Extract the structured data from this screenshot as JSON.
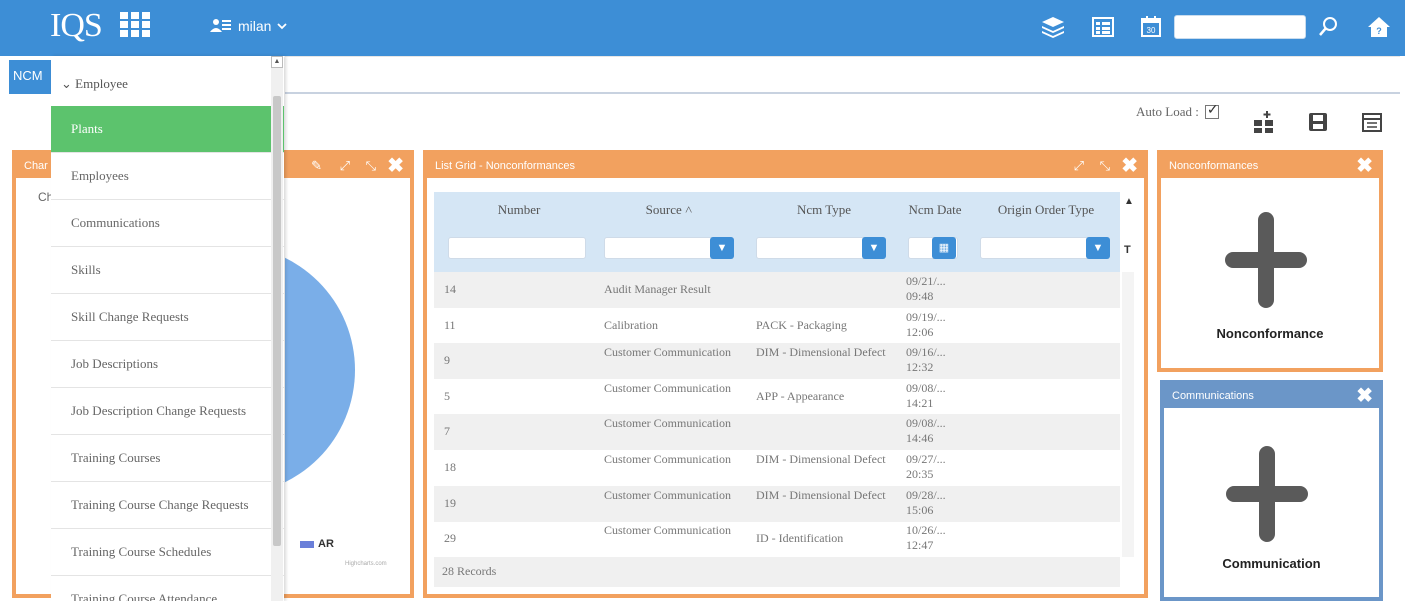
{
  "topbar": {
    "logo": "IQS",
    "user": "milan",
    "icons": [
      "apps-grid-icon",
      "user-icon",
      "chevron-down-icon",
      "layers-icon",
      "list-icon",
      "calendar-icon",
      "search-icon",
      "home-icon"
    ],
    "search_placeholder": "",
    "colors": {
      "bar": "#3d8ed6"
    }
  },
  "tabs": [
    {
      "label": "NCM"
    }
  ],
  "toolbar": {
    "autoload_label": "Auto Load :",
    "autoload_checked": true
  },
  "menu": {
    "header": "Employee",
    "items": [
      {
        "label": "Plants",
        "active": true
      },
      {
        "label": "Employees"
      },
      {
        "label": "Communications"
      },
      {
        "label": "Skills"
      },
      {
        "label": "Skill Change Requests"
      },
      {
        "label": "Job Descriptions"
      },
      {
        "label": "Job Description Change Requests"
      },
      {
        "label": "Training Courses"
      },
      {
        "label": "Training Course Change Requests"
      },
      {
        "label": "Training Course Schedules"
      },
      {
        "label": "Training Course Attendance"
      }
    ]
  },
  "chart_panel": {
    "title": "Char",
    "subtitle": "Ch",
    "legend": "AR",
    "credit": "Highcharts.com"
  },
  "grid_panel": {
    "title": "List Grid - Nonconformances",
    "columns": [
      "Number",
      "Source",
      "Ncm Type",
      "Ncm Date",
      "Origin Order Type"
    ],
    "rows": [
      {
        "number": "14",
        "source": "Audit Manager Result",
        "type": "",
        "date1": "09/21/...",
        "date2": "09:48"
      },
      {
        "number": "11",
        "source": "Calibration",
        "type": "PACK - Packaging",
        "date1": "09/19/...",
        "date2": "12:06"
      },
      {
        "number": "9",
        "source": "Customer Communication",
        "type": "DIM - Dimensional Defect",
        "date1": "09/16/...",
        "date2": "12:32"
      },
      {
        "number": "5",
        "source": "Customer Communication",
        "type": "APP - Appearance",
        "date1": "09/08/...",
        "date2": "14:21"
      },
      {
        "number": "7",
        "source": "Customer Communication",
        "type": "",
        "date1": "09/08/...",
        "date2": "14:46"
      },
      {
        "number": "18",
        "source": "Customer Communication",
        "type": "DIM - Dimensional Defect",
        "date1": "09/27/...",
        "date2": "20:35"
      },
      {
        "number": "19",
        "source": "Customer Communication",
        "type": "DIM - Dimensional Defect",
        "date1": "09/28/...",
        "date2": "15:06"
      },
      {
        "number": "29",
        "source": "Customer Communication",
        "type": "ID - Identification",
        "date1": "10/26/...",
        "date2": "12:47"
      }
    ],
    "footer": "28 Records"
  },
  "widgets": [
    {
      "title": "Nonconformances",
      "label": "Nonconformance",
      "color": "#f2a15f"
    },
    {
      "title": "Communications",
      "label": "Communication",
      "color": "#6b96c8"
    }
  ]
}
